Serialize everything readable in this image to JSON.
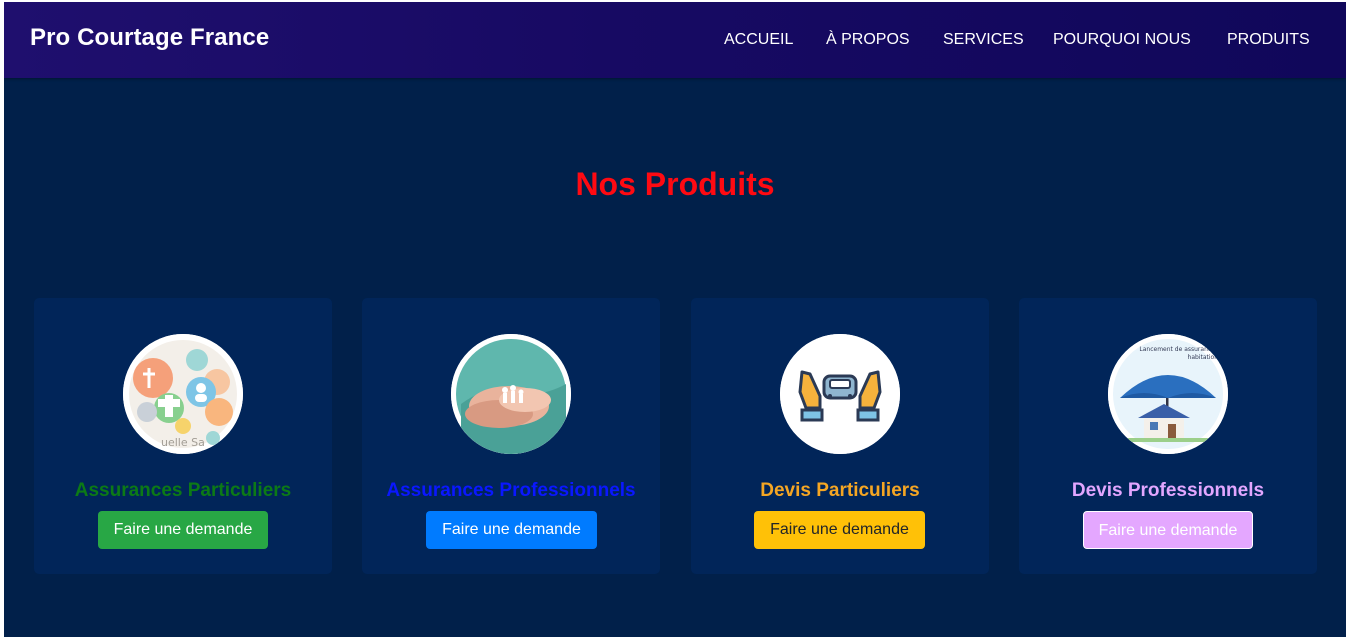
{
  "navbar": {
    "brand": "Pro Courtage France",
    "links": [
      "ACCUEIL",
      "À PROPOS",
      "SERVICES",
      "POURQUOI NOUS",
      "PRODUITS"
    ]
  },
  "section": {
    "title": "Nos Produits"
  },
  "products": [
    {
      "title": "Assurances Particuliers",
      "button": "Faire une demande",
      "image": "mutuelle-sante-image",
      "title_color": "#0c7a16",
      "button_bg": "#28a745",
      "button_fg": "#ffffff"
    },
    {
      "title": "Assurances Professionnels",
      "button": "Faire une demande",
      "image": "family-in-hands-image",
      "title_color": "#0a17ff",
      "button_bg": "#007bff",
      "button_fg": "#ffffff"
    },
    {
      "title": "Devis Particuliers",
      "button": "Faire une demande",
      "image": "car-insurance-hands-icon",
      "title_color": "#f5a623",
      "button_bg": "#ffc107",
      "button_fg": "#212529"
    },
    {
      "title": "Devis Professionnels",
      "button": "Faire une demande",
      "image": "house-umbrella-image",
      "title_color": "#e2a6ff",
      "button_bg": "#e4a7ff",
      "button_fg": "#ffffff",
      "image_text": "Lancement de assurances habitation"
    }
  ]
}
